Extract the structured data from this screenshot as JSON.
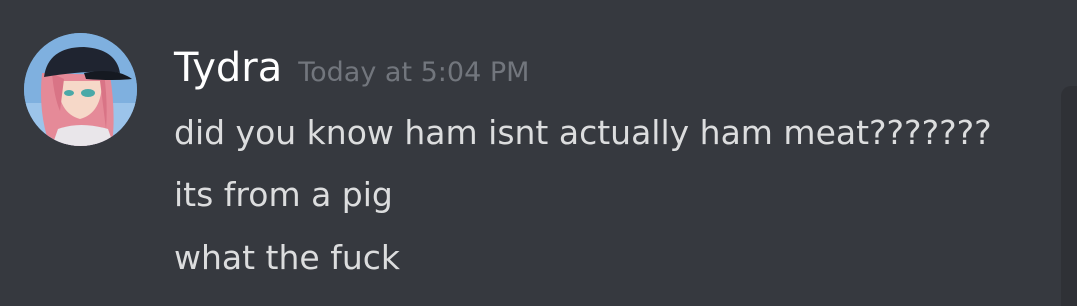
{
  "message": {
    "author": "Tydra",
    "timestamp": "Today at 5:04 PM",
    "avatar_icon": "user-avatar-icon",
    "lines": [
      "did you know ham isnt actually ham meat???????",
      "its from a pig",
      "what the fuck"
    ]
  },
  "colors": {
    "background": "#36393f",
    "username": "#ffffff",
    "timestamp": "#72767d",
    "message_text": "#dcddde",
    "scrollbar_track": "#2f3136"
  }
}
